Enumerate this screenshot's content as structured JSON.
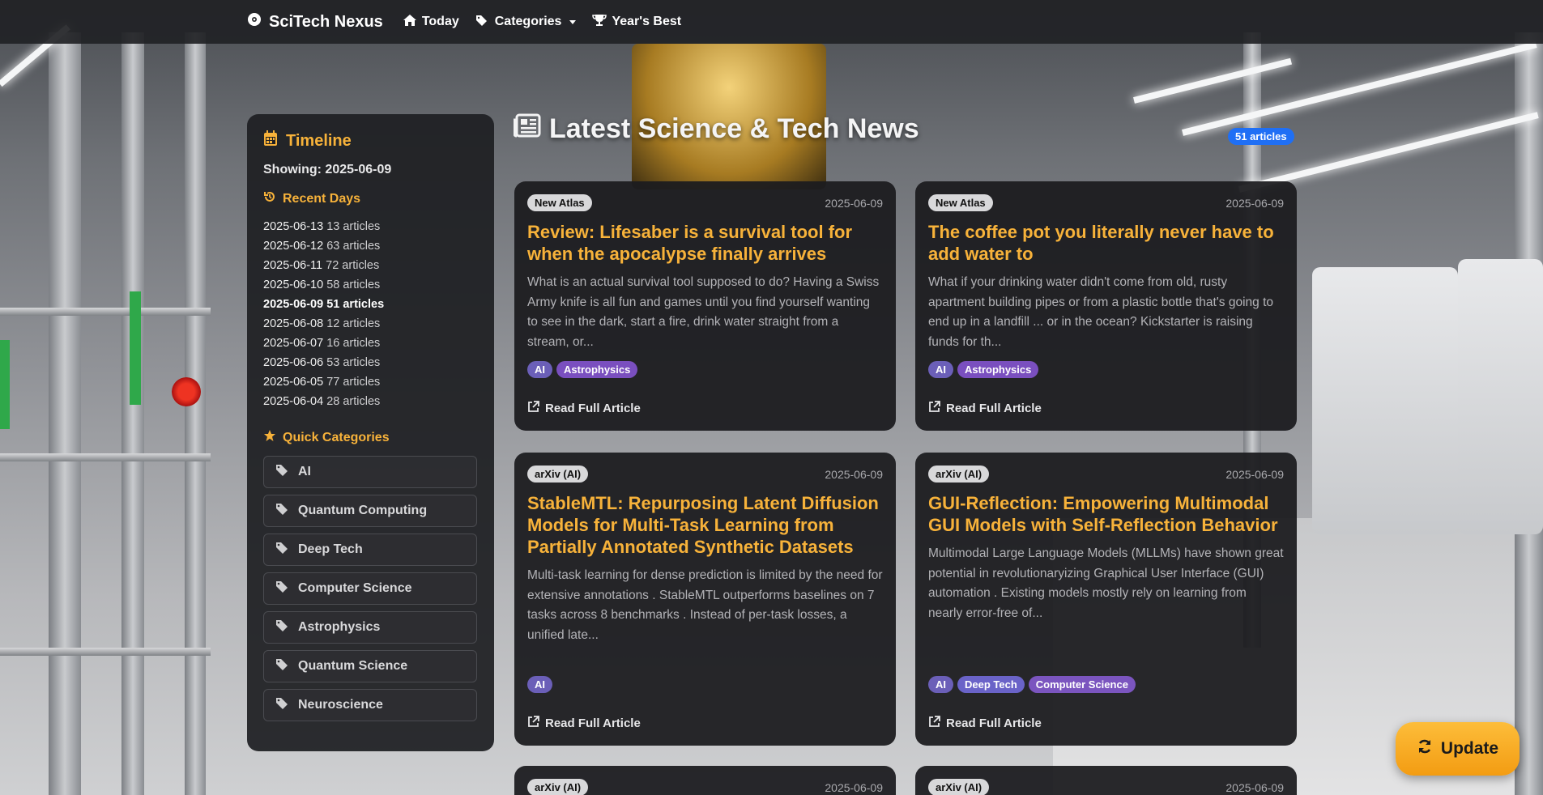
{
  "nav": {
    "brand": "SciTech Nexus",
    "items": [
      {
        "label": "Today",
        "icon": "home-icon"
      },
      {
        "label": "Categories",
        "icon": "tags-icon"
      },
      {
        "label": "Year's Best",
        "icon": "trophy-icon"
      }
    ]
  },
  "sidebar": {
    "title": "Timeline",
    "showing": "Showing: 2025-06-09",
    "recent_heading": "Recent Days",
    "days": [
      {
        "date": "2025-06-13",
        "count": "13 articles",
        "active": false
      },
      {
        "date": "2025-06-12",
        "count": "63 articles",
        "active": false
      },
      {
        "date": "2025-06-11",
        "count": "72 articles",
        "active": false
      },
      {
        "date": "2025-06-10",
        "count": "58 articles",
        "active": false
      },
      {
        "date": "2025-06-09",
        "count": "51 articles",
        "active": true
      },
      {
        "date": "2025-06-08",
        "count": "12 articles",
        "active": false
      },
      {
        "date": "2025-06-07",
        "count": "16 articles",
        "active": false
      },
      {
        "date": "2025-06-06",
        "count": "53 articles",
        "active": false
      },
      {
        "date": "2025-06-05",
        "count": "77 articles",
        "active": false
      },
      {
        "date": "2025-06-04",
        "count": "28 articles",
        "active": false
      }
    ],
    "categories_heading": "Quick Categories",
    "categories": [
      "AI",
      "Quantum Computing",
      "Deep Tech",
      "Computer Science",
      "Astrophysics",
      "Quantum Science",
      "Neuroscience"
    ]
  },
  "main": {
    "title": "Latest Science & Tech News",
    "count_badge": "51 articles",
    "read_label": "Read Full Article",
    "cards": [
      {
        "source": "New Atlas",
        "date": "2025-06-09",
        "title": "Review: Lifesaber is a survival tool for when the apocalypse finally arrives",
        "excerpt": "What is an actual survival tool supposed to do? Having a Swiss Army knife is all fun and games until you find yourself wanting to see in the dark, start a fire, drink water straight from a stream, or...",
        "tags": [
          "AI",
          "Astrophysics"
        ]
      },
      {
        "source": "New Atlas",
        "date": "2025-06-09",
        "title": "The coffee pot you literally never have to add water to",
        "excerpt": "What if your drinking water didn't come from old, rusty apartment building pipes or from a plastic bottle that's going to end up in a landfill ... or in the ocean? Kickstarter is raising funds for th...",
        "tags": [
          "AI",
          "Astrophysics"
        ]
      },
      {
        "source": "arXiv (AI)",
        "date": "2025-06-09",
        "title": "StableMTL: Repurposing Latent Diffusion Models for Multi-Task Learning from Partially Annotated Synthetic Datasets",
        "excerpt": "Multi-task learning for dense prediction is limited by the need for extensive annotations . StableMTL outperforms baselines on 7 tasks across 8 benchmarks . Instead of per-task losses, a unified late...",
        "tags": [
          "AI"
        ]
      },
      {
        "source": "arXiv (AI)",
        "date": "2025-06-09",
        "title": "GUI-Reflection: Empowering Multimodal GUI Models with Self-Reflection Behavior",
        "excerpt": "Multimodal Large Language Models (MLLMs) have shown great potential in revolutionaryizing Graphical User Interface (GUI) automation . Existing models mostly rely on learning from nearly error-free of...",
        "tags": [
          "AI",
          "Deep Tech",
          "Computer Science"
        ]
      },
      {
        "source": "arXiv (AI)",
        "date": "2025-06-09"
      },
      {
        "source": "arXiv (AI)",
        "date": "2025-06-09"
      }
    ]
  },
  "update_button": "Update",
  "colors": {
    "accent": "#f7b23a",
    "badge_blue": "#1f6ff5",
    "tag_purple": "#6b5fc9",
    "update": "#f9a825"
  }
}
